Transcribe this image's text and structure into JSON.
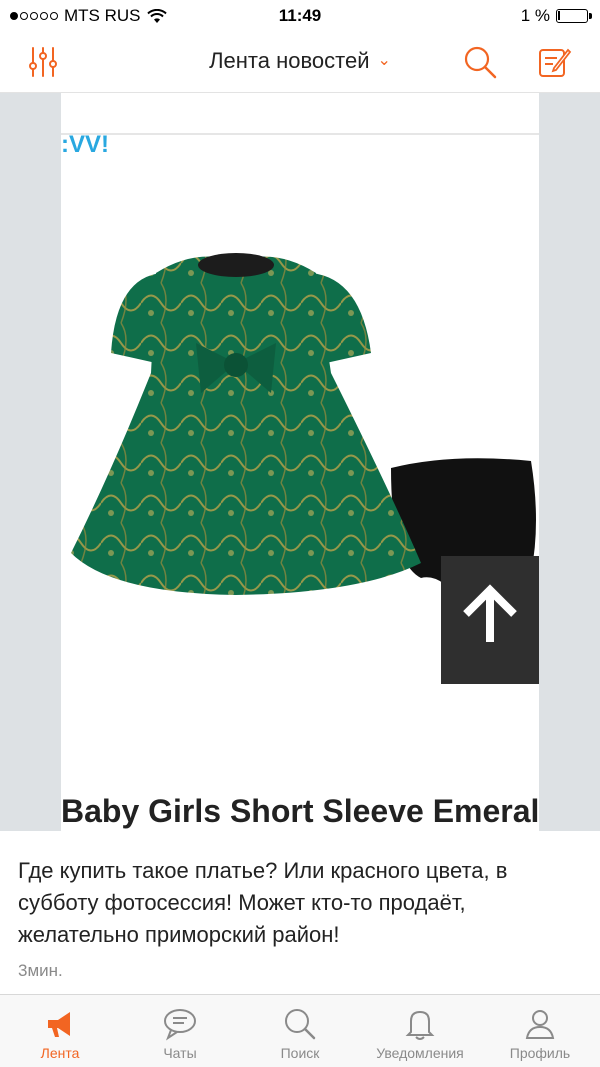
{
  "status_bar": {
    "carrier": "MTS RUS",
    "time": "11:49",
    "battery": "1 %"
  },
  "nav": {
    "title": "Лента новостей"
  },
  "post": {
    "brand_badge": ":VV!",
    "product_title": "Baby Girls Short Sleeve Emerald",
    "text": "Где купить такое платье? Или красного цвета, в субботу фотосессия! Может кто-то продаёт, желательно приморский район!",
    "time": "3мин."
  },
  "tabs": [
    {
      "label": "Лента",
      "icon": "megaphone-icon",
      "active": true
    },
    {
      "label": "Чаты",
      "icon": "chat-bubble-icon",
      "active": false
    },
    {
      "label": "Поиск",
      "icon": "search-icon",
      "active": false
    },
    {
      "label": "Уведомления",
      "icon": "bell-icon",
      "active": false
    },
    {
      "label": "Профиль",
      "icon": "profile-icon",
      "active": false
    }
  ],
  "colors": {
    "accent": "#f26522",
    "brand_blue": "#29a8e0",
    "feed_bg": "#dde1e4"
  }
}
